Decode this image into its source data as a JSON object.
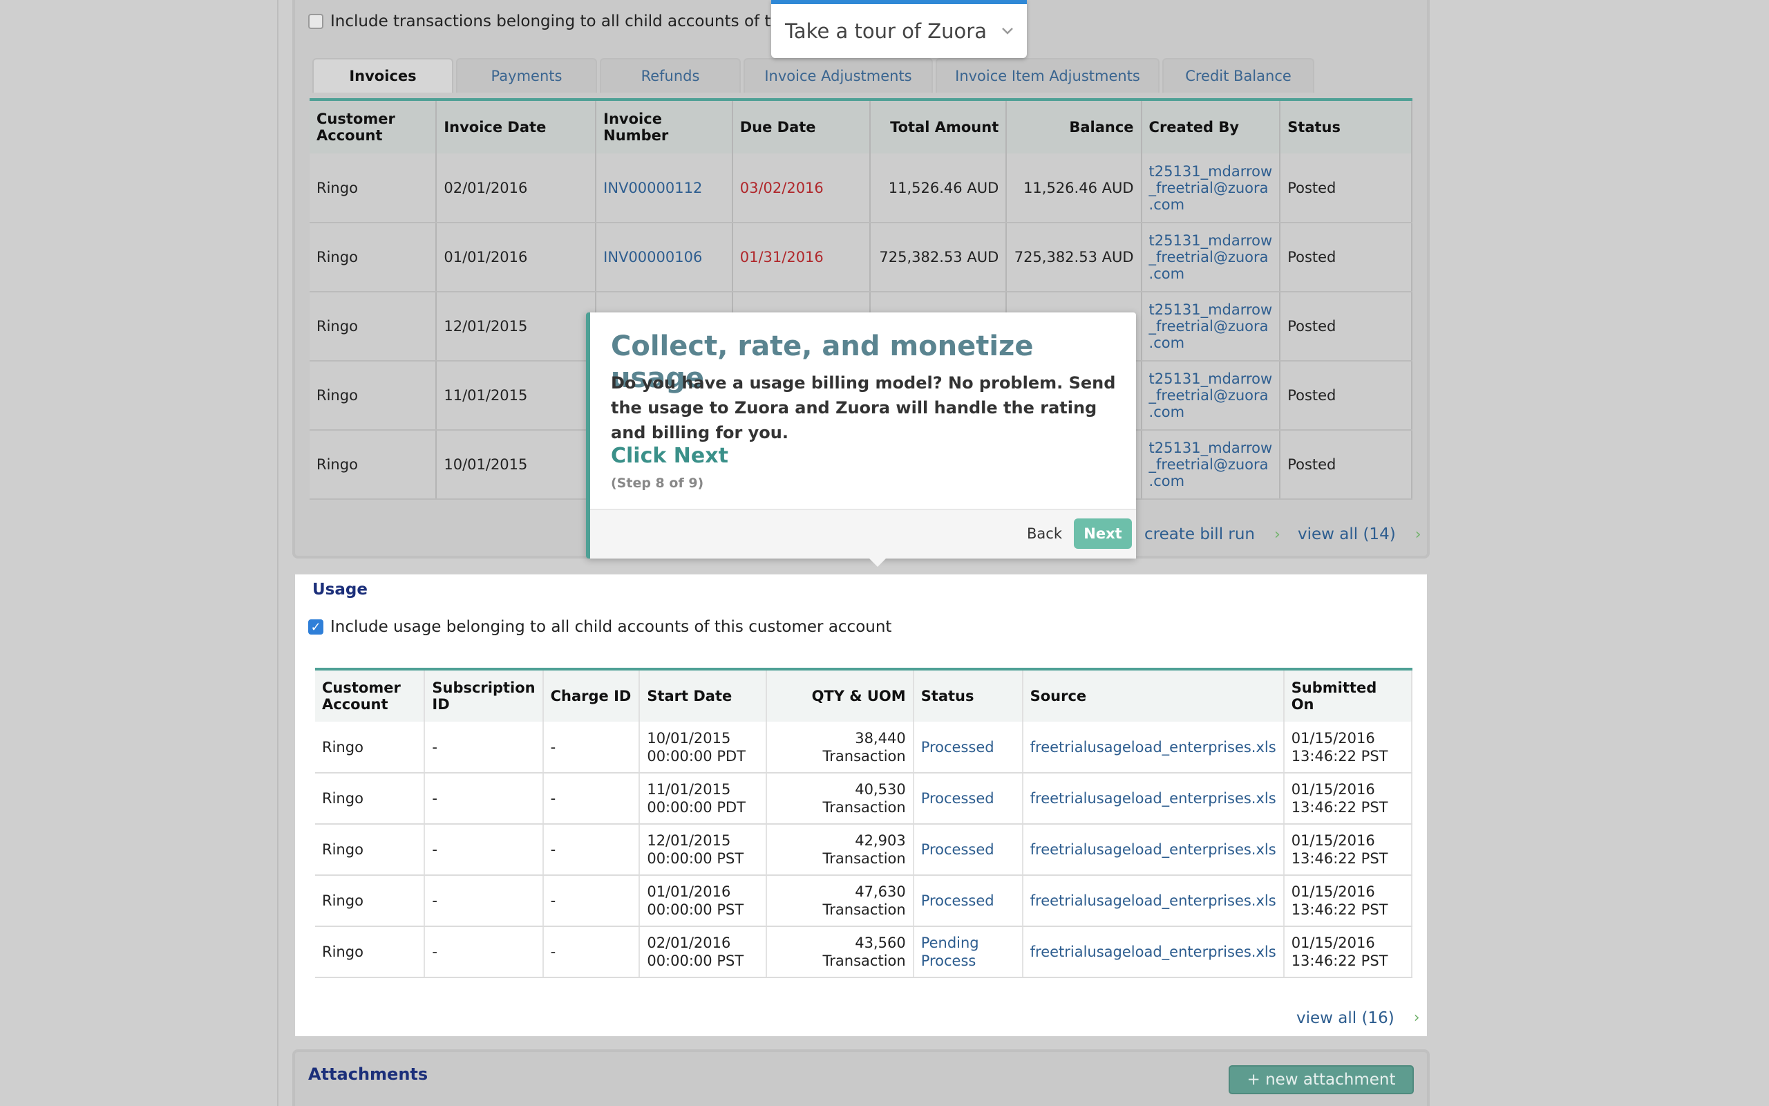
{
  "invoices_section": {
    "include_label": "Include transactions belonging to all child accounts of this",
    "tabs": [
      {
        "label": "Invoices"
      },
      {
        "label": "Payments"
      },
      {
        "label": "Refunds"
      },
      {
        "label": "Invoice Adjustments"
      },
      {
        "label": "Invoice Item Adjustments"
      },
      {
        "label": "Credit Balance"
      }
    ],
    "headers": [
      "Customer Account",
      "Invoice Date",
      "Invoice Number",
      "Due Date",
      "Total Amount",
      "Balance",
      "Created By",
      "Status"
    ],
    "rows": [
      {
        "account": "Ringo",
        "invoice_date": "02/01/2016",
        "invoice_number": "INV00000112",
        "due_date": "03/02/2016",
        "total": "11,526.46 AUD",
        "balance": "11,526.46 AUD",
        "created_by": "t25131_mdarrow _freetrial@zuora .com",
        "status": "Posted"
      },
      {
        "account": "Ringo",
        "invoice_date": "01/01/2016",
        "invoice_number": "INV00000106",
        "due_date": "01/31/2016",
        "total": "725,382.53 AUD",
        "balance": "725,382.53 AUD",
        "created_by": "t25131_mdarrow _freetrial@zuora .com",
        "status": "Posted"
      },
      {
        "account": "Ringo",
        "invoice_date": "12/01/2015",
        "invoice_number": "",
        "due_date": "",
        "total": "",
        "balance": "",
        "created_by": "t25131_mdarrow _freetrial@zuora .com",
        "status": "Posted"
      },
      {
        "account": "Ringo",
        "invoice_date": "11/01/2015",
        "invoice_number": "",
        "due_date": "",
        "total": "",
        "balance": "",
        "created_by": "t25131_mdarrow _freetrial@zuora .com",
        "status": "Posted"
      },
      {
        "account": "Ringo",
        "invoice_date": "10/01/2015",
        "invoice_number": "",
        "due_date": "",
        "total": "",
        "balance": "",
        "created_by": "t25131_mdarrow _freetrial@zuora .com",
        "status": "Posted"
      }
    ],
    "create_bill_run": "create bill run",
    "view_all": "view all (14)"
  },
  "tour": {
    "dropdown_label": "Take a tour of Zuora",
    "popover_title": "Collect, rate, and monetize usage",
    "popover_body": "Do you have a usage billing model? No problem. Send the usage to Zuora and Zuora will handle the rating and billing for you.",
    "popover_action": "Click Next",
    "popover_step": "(Step 8 of 9)",
    "back_label": "Back",
    "next_label": "Next"
  },
  "usage_section": {
    "title": "Usage",
    "include_label": "Include usage belonging to all child accounts of this customer account",
    "include_checked": true,
    "headers": [
      "Customer Account",
      "Subscription ID",
      "Charge ID",
      "Start Date",
      "QTY & UOM",
      "Status",
      "Source",
      "Submitted On"
    ],
    "rows": [
      {
        "account": "Ringo",
        "subscription_id": "-",
        "charge_id": "-",
        "start_date": "10/01/2015 00:00:00 PDT",
        "qty": "38,440 Transaction",
        "status": "Processed",
        "source": "freetrialusageload_enterprises.xls",
        "submitted": "01/15/2016 13:46:22 PST"
      },
      {
        "account": "Ringo",
        "subscription_id": "-",
        "charge_id": "-",
        "start_date": "11/01/2015 00:00:00 PDT",
        "qty": "40,530 Transaction",
        "status": "Processed",
        "source": "freetrialusageload_enterprises.xls",
        "submitted": "01/15/2016 13:46:22 PST"
      },
      {
        "account": "Ringo",
        "subscription_id": "-",
        "charge_id": "-",
        "start_date": "12/01/2015 00:00:00 PST",
        "qty": "42,903 Transaction",
        "status": "Processed",
        "source": "freetrialusageload_enterprises.xls",
        "submitted": "01/15/2016 13:46:22 PST"
      },
      {
        "account": "Ringo",
        "subscription_id": "-",
        "charge_id": "-",
        "start_date": "01/01/2016 00:00:00 PST",
        "qty": "47,630 Transaction",
        "status": "Processed",
        "source": "freetrialusageload_enterprises.xls",
        "submitted": "01/15/2016 13:46:22 PST"
      },
      {
        "account": "Ringo",
        "subscription_id": "-",
        "charge_id": "-",
        "start_date": "02/01/2016 00:00:00 PST",
        "qty": "43,560 Transaction",
        "status": "Pending Process",
        "source": "freetrialusageload_enterprises.xls",
        "submitted": "01/15/2016 13:46:22 PST"
      }
    ],
    "view_all": "view all (16)"
  },
  "attachments_section": {
    "title": "Attachments",
    "new_button": "+ new attachment"
  },
  "colors": {
    "accent_teal": "#4ea095",
    "link_blue": "#2d5d8f",
    "due_red": "#b0272b",
    "tour_blue": "#2f88d6"
  }
}
